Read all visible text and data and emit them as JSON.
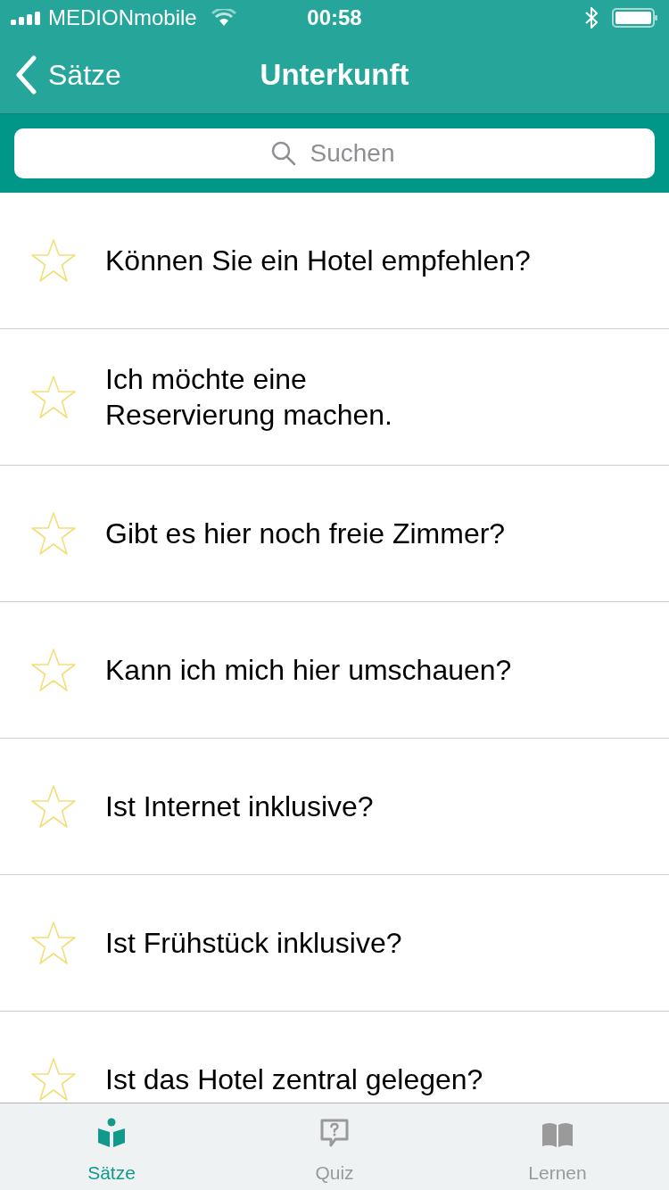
{
  "status_bar": {
    "carrier": "MEDIONmobile",
    "time": "00:58"
  },
  "nav": {
    "back_label": "Sätze",
    "title": "Unterkunft"
  },
  "search": {
    "placeholder": "Suchen"
  },
  "phrases": [
    {
      "text": "Können Sie ein Hotel empfehlen?",
      "favorite": false
    },
    {
      "text": "Ich möchte eine\nReservierung machen.",
      "favorite": false
    },
    {
      "text": "Gibt es hier noch freie Zimmer?",
      "favorite": false
    },
    {
      "text": "Kann ich mich hier umschauen?",
      "favorite": false
    },
    {
      "text": "Ist Internet inklusive?",
      "favorite": false
    },
    {
      "text": "Ist Frühstück inklusive?",
      "favorite": false
    },
    {
      "text": "Ist das Hotel zentral gelegen?",
      "favorite": false
    }
  ],
  "tabs": [
    {
      "label": "Sätze",
      "kind": "reader",
      "selected": true
    },
    {
      "label": "Quiz",
      "kind": "quiz",
      "selected": false
    },
    {
      "label": "Lernen",
      "kind": "book",
      "selected": false
    }
  ]
}
